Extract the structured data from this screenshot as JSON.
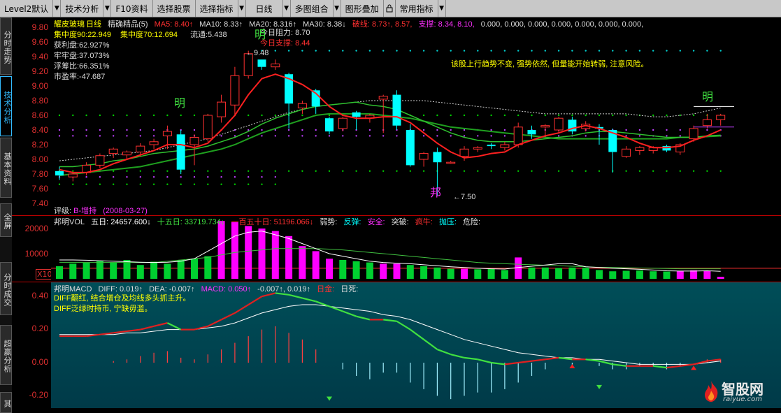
{
  "toolbar": {
    "items": [
      "Level2默认",
      "技术分析",
      "F10资料",
      "选择股票",
      "选择指标",
      "日线",
      "多图组合",
      "图形叠加",
      "常用指标"
    ]
  },
  "sidebar": {
    "tabs": [
      "分时走势",
      "技术分析",
      "基本资料",
      "全屏",
      "分时成交",
      "超赢分析",
      "其"
    ]
  },
  "main": {
    "stock_name": "耀皮玻璃",
    "period": "日线",
    "indicator_name": "精确精品(5)",
    "ma": {
      "ma5": "MA5: 8.40↑",
      "ma10": "MA10: 8.33↑",
      "ma20": "MA20: 8.316↑",
      "ma30": "MA30: 8.38↓"
    },
    "po": "破线: 8.73↑, 8.57,",
    "zc": "支撑: 8.34, 8.10,",
    "tail": "0.000, 0.000, 0.000, 0.000, 0.000, 0.000, 0.000,",
    "stats": [
      "集中度90:22.949",
      "集中度70:12.694",
      "流通:5.438",
      "获利盘:62.927%",
      "牢牢盘:37.073%",
      "浮筹比:66.351%",
      "市盈率:-47.687"
    ],
    "resist": "今日阻力: 8.70",
    "support": "今日支撑: 8.44",
    "comment": "该股上行趋势不变, 强势依然, 但量能开始转弱, 注意风险。",
    "high_label": "←9.48",
    "low_label": "←7.50",
    "ming": "明",
    "bang": "邦",
    "rating_label": "评级:",
    "rating_value": "B-增持",
    "rating_date": "(2008-03-27)",
    "yticks": [
      "9.80",
      "9.60",
      "9.40",
      "9.20",
      "9.00",
      "8.80",
      "8.60",
      "8.40",
      "8.20",
      "8.00",
      "7.80",
      "7.60",
      "7.40"
    ]
  },
  "volume": {
    "title": "邦明VOL",
    "d5": "五日: 24657.600↓",
    "d15": "十五日: 33719.734↓",
    "d150": "一百五十日: 51196.066↓",
    "tags": [
      "弱势:",
      "反弹:",
      "安全:",
      "突破:",
      "疯牛:",
      "抛压:",
      "危险:"
    ],
    "yticks": [
      "20000",
      "10000"
    ],
    "unit": "X10"
  },
  "macd": {
    "title": "邦明MACD",
    "diff": "DIFF: 0.019↑",
    "dea": "DEA: -0.007↑",
    "macd": "MACD: 0.050↑",
    "extra": "-0.007↑, 0.019↑",
    "jin": "日金:",
    "si": "日死:",
    "note1": "DIFF翻红, 结合增仓及均线多头抓主升。",
    "note2": "DIFF泛绿时持币, 宁缺毋滥。",
    "yticks": [
      "0.40",
      "0.20",
      "0.00",
      "-0.20"
    ]
  },
  "watermark": {
    "cn": "智股网",
    "url": "raiyue.com"
  },
  "colors": {
    "up": "#ff3030",
    "down": "#00ffff",
    "ma5": "#ff2020",
    "ma10": "#ffffff",
    "ma20": "#00c000",
    "vol_pink": "#ff00ff",
    "vol_green": "#00d030"
  },
  "chart_data": {
    "type": "candlestick",
    "ylim": [
      7.4,
      9.9
    ],
    "candles": [
      {
        "o": 7.84,
        "h": 7.9,
        "c": 7.78,
        "l": 7.72
      },
      {
        "o": 7.76,
        "h": 7.82,
        "c": 7.8,
        "l": 7.7
      },
      {
        "o": 7.82,
        "h": 7.96,
        "c": 7.92,
        "l": 7.78
      },
      {
        "o": 7.92,
        "h": 8.08,
        "c": 8.05,
        "l": 7.88
      },
      {
        "o": 8.08,
        "h": 8.16,
        "c": 8.14,
        "l": 8.02
      },
      {
        "o": 8.06,
        "h": 8.12,
        "c": 8.1,
        "l": 8.0
      },
      {
        "o": 8.1,
        "h": 8.22,
        "c": 8.18,
        "l": 8.04
      },
      {
        "o": 8.2,
        "h": 8.28,
        "c": 8.24,
        "l": 8.14
      },
      {
        "o": 8.32,
        "h": 8.46,
        "c": 8.38,
        "l": 8.14
      },
      {
        "o": 8.34,
        "h": 8.4,
        "c": 7.86,
        "l": 7.8
      },
      {
        "o": 8.2,
        "h": 8.34,
        "c": 8.3,
        "l": 7.92
      },
      {
        "o": 8.28,
        "h": 8.62,
        "c": 8.6,
        "l": 8.24
      },
      {
        "o": 8.58,
        "h": 8.88,
        "c": 8.78,
        "l": 8.5
      },
      {
        "o": 8.74,
        "h": 9.26,
        "c": 9.14,
        "l": 8.6
      },
      {
        "o": 9.14,
        "h": 9.48,
        "c": 9.44,
        "l": 9.1
      },
      {
        "o": 9.36,
        "h": 9.34,
        "c": 9.26,
        "l": 9.22
      },
      {
        "o": 9.26,
        "h": 9.36,
        "c": 9.3,
        "l": 9.22
      },
      {
        "o": 9.16,
        "h": 9.18,
        "c": 8.76,
        "l": 8.42
      },
      {
        "o": 8.7,
        "h": 8.8,
        "c": 8.76,
        "l": 8.62
      },
      {
        "o": 8.94,
        "h": 8.96,
        "c": 8.72,
        "l": 8.62
      },
      {
        "o": 8.56,
        "h": 8.58,
        "c": 8.38,
        "l": 8.34
      },
      {
        "o": 8.42,
        "h": 8.58,
        "c": 8.56,
        "l": 8.38
      },
      {
        "o": 8.64,
        "h": 8.66,
        "c": 8.58,
        "l": 8.4
      },
      {
        "o": 8.56,
        "h": 8.62,
        "c": 8.6,
        "l": 8.5
      },
      {
        "o": 8.82,
        "h": 8.88,
        "c": 8.86,
        "l": 8.36
      },
      {
        "o": 8.88,
        "h": 8.94,
        "c": 8.46,
        "l": 8.4
      },
      {
        "o": 8.4,
        "h": 8.48,
        "c": 7.92,
        "l": 7.9
      },
      {
        "o": 8.0,
        "h": 8.1,
        "c": 8.08,
        "l": 7.9
      },
      {
        "o": 8.1,
        "h": 8.16,
        "c": 7.96,
        "l": 7.5
      },
      {
        "o": 7.96,
        "h": 7.98,
        "c": 7.96,
        "l": 7.94
      },
      {
        "o": 8.04,
        "h": 8.18,
        "c": 8.14,
        "l": 7.98
      },
      {
        "o": 8.14,
        "h": 8.18,
        "c": 8.16,
        "l": 8.1
      },
      {
        "o": 8.2,
        "h": 8.22,
        "c": 8.18,
        "l": 8.14
      },
      {
        "o": 8.16,
        "h": 8.24,
        "c": 8.2,
        "l": 8.12
      },
      {
        "o": 8.2,
        "h": 8.5,
        "c": 8.44,
        "l": 8.16
      },
      {
        "o": 8.4,
        "h": 8.46,
        "c": 8.34,
        "l": 8.28
      },
      {
        "o": 8.44,
        "h": 8.48,
        "c": 8.46,
        "l": 8.3
      },
      {
        "o": 8.4,
        "h": 8.58,
        "c": 8.56,
        "l": 8.36
      },
      {
        "o": 8.54,
        "h": 8.58,
        "c": 8.38,
        "l": 8.34
      },
      {
        "o": 8.42,
        "h": 8.52,
        "c": 8.48,
        "l": 8.38
      },
      {
        "o": 8.44,
        "h": 8.48,
        "c": 8.42,
        "l": 8.2
      },
      {
        "o": 8.4,
        "h": 8.42,
        "c": 8.1,
        "l": 7.82
      },
      {
        "o": 8.04,
        "h": 8.18,
        "c": 8.14,
        "l": 8.02
      },
      {
        "o": 8.12,
        "h": 8.18,
        "c": 8.16,
        "l": 8.06
      },
      {
        "o": 8.12,
        "h": 8.18,
        "c": 8.16,
        "l": 8.08
      },
      {
        "o": 8.18,
        "h": 8.2,
        "c": 8.12,
        "l": 8.1
      },
      {
        "o": 8.1,
        "h": 8.22,
        "c": 8.2,
        "l": 8.06
      },
      {
        "o": 8.28,
        "h": 8.46,
        "c": 8.42,
        "l": 8.24
      },
      {
        "o": 8.46,
        "h": 8.62,
        "c": 8.54,
        "l": 8.42
      },
      {
        "o": 8.54,
        "h": 8.62,
        "c": 8.6,
        "l": 8.46
      }
    ],
    "ma5": [
      7.86,
      7.82,
      7.82,
      7.86,
      7.94,
      8.0,
      8.06,
      8.12,
      8.2,
      8.2,
      8.16,
      8.22,
      8.4,
      8.6,
      8.88,
      9.1,
      9.16,
      9.1,
      9.02,
      8.9,
      8.72,
      8.6,
      8.56,
      8.56,
      8.58,
      8.58,
      8.5,
      8.36,
      8.22,
      8.1,
      8.02,
      8.04,
      8.08,
      8.1,
      8.2,
      8.26,
      8.32,
      8.36,
      8.42,
      8.46,
      8.42,
      8.36,
      8.3,
      8.22,
      8.16,
      8.16,
      8.18,
      8.26,
      8.32,
      8.4
    ],
    "ma10": [
      7.9,
      7.9,
      7.92,
      7.94,
      7.98,
      8.0,
      8.04,
      8.08,
      8.1,
      8.12,
      8.14,
      8.18,
      8.24,
      8.3,
      8.38,
      8.48,
      8.56,
      8.62,
      8.68,
      8.72,
      8.74,
      8.76,
      8.78,
      8.74,
      8.72,
      8.68,
      8.6,
      8.52,
      8.44,
      8.36,
      8.3,
      8.26,
      8.24,
      8.24,
      8.24,
      8.26,
      8.28,
      8.3,
      8.32,
      8.36,
      8.38,
      8.38,
      8.36,
      8.34,
      8.32,
      8.3,
      8.3,
      8.3,
      8.32,
      8.33
    ],
    "ma20": [
      7.78,
      7.8,
      7.82,
      7.84,
      7.86,
      7.88,
      7.9,
      7.94,
      7.98,
      8.02,
      8.06,
      8.1,
      8.14,
      8.2,
      8.28,
      8.36,
      8.42,
      8.48,
      8.54,
      8.6,
      8.62,
      8.62,
      8.62,
      8.62,
      8.6,
      8.58,
      8.56,
      8.52,
      8.48,
      8.44,
      8.42,
      8.4,
      8.38,
      8.36,
      8.34,
      8.32,
      8.3,
      8.28,
      8.28,
      8.28,
      8.28,
      8.28,
      8.28,
      8.28,
      8.28,
      8.28,
      8.3,
      8.3,
      8.31,
      8.32
    ],
    "ma30": [
      7.98,
      8.0,
      8.02,
      8.04,
      8.06,
      8.08,
      8.1,
      8.12,
      8.16,
      8.2,
      8.24,
      8.28,
      8.34,
      8.4,
      8.46,
      8.52,
      8.58,
      8.64,
      8.68,
      8.72,
      8.74,
      8.76,
      8.78,
      8.8,
      8.8,
      8.8,
      8.8,
      8.8,
      8.78,
      8.76,
      8.74,
      8.72,
      8.7,
      8.68,
      8.66,
      8.64,
      8.62,
      8.62,
      8.62,
      8.62,
      8.62,
      8.62,
      8.62,
      8.6,
      8.58,
      8.58,
      8.6,
      8.62,
      8.66,
      8.7
    ],
    "volume": [
      5000,
      6000,
      6500,
      7000,
      6500,
      7500,
      5500,
      6800,
      6000,
      7500,
      8000,
      9000,
      23000,
      22500,
      21000,
      20000,
      19000,
      17000,
      13000,
      11000,
      8000,
      7500,
      7000,
      6500,
      6000,
      6000,
      5500,
      5000,
      4500,
      4000,
      4000,
      3800,
      4000,
      3500,
      8500,
      4500,
      4500,
      4300,
      4500,
      4400,
      3500,
      3000,
      3200,
      3300,
      3000,
      2900,
      3100,
      3400,
      3200,
      800
    ],
    "vol_up": [
      0,
      0,
      0,
      0,
      0,
      0,
      0,
      0,
      0,
      0,
      0,
      0,
      1,
      1,
      1,
      1,
      1,
      1,
      1,
      1,
      1,
      0,
      0,
      0,
      1,
      1,
      0,
      0,
      0,
      0,
      1,
      0,
      0,
      0,
      1,
      0,
      0,
      0,
      0,
      0,
      0,
      0,
      0,
      0,
      0,
      0,
      1,
      1,
      1,
      1
    ],
    "vol_ma5": [
      7500,
      7500,
      7400,
      7200,
      7000,
      6800,
      6600,
      6500,
      6600,
      7000,
      8000,
      11000,
      14000,
      17000,
      18500,
      19000,
      17500,
      16000,
      14000,
      12000,
      10000,
      9000,
      8000,
      7000,
      6500,
      6200,
      6000,
      5600,
      5200,
      4800,
      4500,
      4200,
      4000,
      3900,
      4500,
      5000,
      5500,
      6000,
      6000,
      4800,
      4500,
      4200,
      4000,
      3800,
      3500,
      3200,
      3100,
      3100,
      3200,
      3000
    ],
    "vol_ma15": [
      6500,
      6500,
      6500,
      6500,
      6500,
      6500,
      6500,
      6500,
      7000,
      7500,
      8000,
      8500,
      9500,
      10500,
      11000,
      11500,
      12000,
      12000,
      12000,
      12000,
      11800,
      11500,
      11000,
      10500,
      10000,
      9500,
      9000,
      8500,
      8000,
      7500,
      7000,
      6500,
      6200,
      6000,
      5800,
      5600,
      5400,
      5200,
      5000,
      4800,
      4600,
      4500,
      4400,
      4300,
      4200,
      4100,
      4000,
      4000,
      4000,
      4000
    ],
    "diff": [
      0.16,
      0.16,
      0.16,
      0.17,
      0.18,
      0.19,
      0.2,
      0.22,
      0.24,
      0.2,
      0.2,
      0.22,
      0.26,
      0.3,
      0.35,
      0.4,
      0.42,
      0.41,
      0.39,
      0.37,
      0.34,
      0.31,
      0.28,
      0.26,
      0.26,
      0.25,
      0.2,
      0.14,
      0.08,
      0.05,
      0.03,
      0.02,
      0.0,
      -0.01,
      0.0,
      0.01,
      0.02,
      0.03,
      0.02,
      0.02,
      0.01,
      -0.01,
      -0.02,
      -0.02,
      -0.02,
      -0.03,
      -0.02,
      -0.01,
      0.01,
      0.02
    ],
    "dea": [
      0.17,
      0.17,
      0.17,
      0.17,
      0.17,
      0.18,
      0.18,
      0.19,
      0.2,
      0.2,
      0.2,
      0.21,
      0.22,
      0.24,
      0.27,
      0.3,
      0.32,
      0.34,
      0.35,
      0.35,
      0.34,
      0.33,
      0.32,
      0.31,
      0.29,
      0.28,
      0.26,
      0.23,
      0.2,
      0.17,
      0.14,
      0.12,
      0.1,
      0.08,
      0.06,
      0.05,
      0.04,
      0.03,
      0.03,
      0.02,
      0.02,
      0.01,
      0.0,
      -0.01,
      -0.01,
      -0.01,
      -0.01,
      -0.01,
      0.0,
      0.01
    ],
    "macd_bars": [
      0.0,
      0.0,
      0.0,
      0.0,
      0.01,
      0.02,
      0.04,
      0.06,
      0.07,
      0.03,
      0.02,
      0.05,
      0.08,
      0.12,
      0.16,
      0.2,
      0.22,
      0.18,
      0.14,
      0.08,
      0.0,
      -0.04,
      -0.08,
      -0.1,
      -0.06,
      -0.06,
      -0.12,
      -0.16,
      -0.2,
      -0.22,
      -0.2,
      -0.18,
      -0.18,
      -0.16,
      -0.12,
      -0.08,
      -0.04,
      0.0,
      -0.02,
      0.0,
      -0.02,
      -0.04,
      -0.04,
      -0.02,
      -0.02,
      -0.04,
      -0.02,
      0.0,
      0.02,
      0.02
    ]
  }
}
